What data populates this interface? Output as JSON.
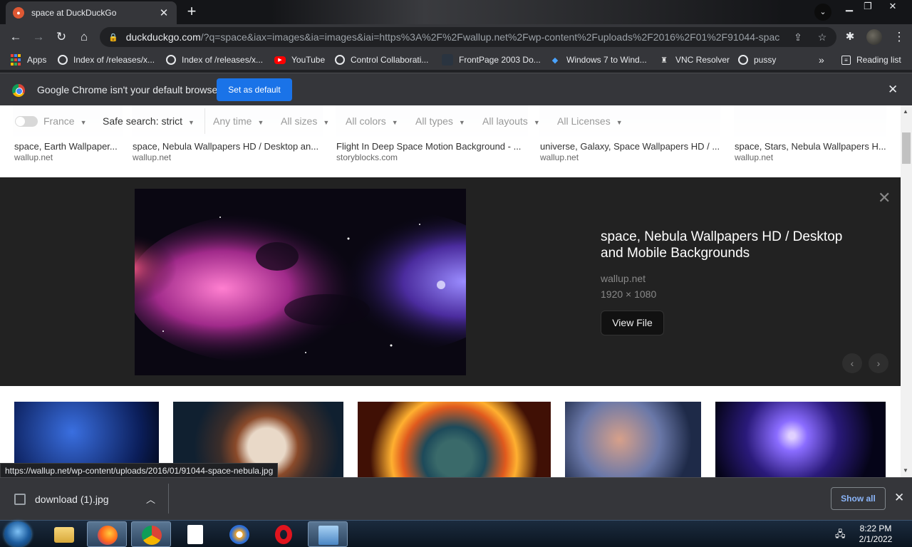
{
  "browser": {
    "tab_title": "space at DuckDuckGo",
    "url_host": "duckduckgo.com",
    "url_path": "/?q=space&iax=images&ia=images&iai=https%3A%2F%2Fwallup.net%2Fwp-content%2Fuploads%2F2016%2F01%2F91044-space-..."
  },
  "bookmarks": [
    {
      "label": "Apps",
      "icon": "apps-grid-icon"
    },
    {
      "label": "Index of /releases/x...",
      "icon": "globe-icon"
    },
    {
      "label": "Index of /releases/x...",
      "icon": "globe-icon"
    },
    {
      "label": "YouTube",
      "icon": "youtube-icon"
    },
    {
      "label": "Control Collaborati...",
      "icon": "globe-icon"
    },
    {
      "label": "FrontPage 2003 Do...",
      "icon": "page-icon"
    },
    {
      "label": "Windows 7 to Wind...",
      "icon": "windows-icon"
    },
    {
      "label": "VNC Resolver",
      "icon": "vnc-icon"
    },
    {
      "label": "pussy",
      "icon": "globe-icon"
    }
  ],
  "bookmarks_more": "»",
  "reading_list": "Reading list",
  "infobar": {
    "message": "Google Chrome isn't your default browser",
    "button": "Set as default"
  },
  "filters": {
    "region": "France",
    "safe_search": "Safe search: strict",
    "time": "Any time",
    "sizes": "All sizes",
    "colors": "All colors",
    "types": "All types",
    "layouts": "All layouts",
    "licenses": "All Licenses"
  },
  "top_results": [
    {
      "caption": "space, Earth Wallpaper...",
      "source": "wallup.net"
    },
    {
      "caption": "space, Nebula Wallpapers HD / Desktop an...",
      "source": "wallup.net"
    },
    {
      "caption": "Flight In Deep Space Motion Background - ...",
      "source": "storyblocks.com"
    },
    {
      "caption": "universe, Galaxy, Space Wallpapers HD / ...",
      "source": "wallup.net"
    },
    {
      "caption": "space, Stars, Nebula Wallpapers H...",
      "source": "wallup.net"
    }
  ],
  "detail": {
    "title": "space, Nebula Wallpapers HD / Desktop and Mobile Backgrounds",
    "source": "wallup.net",
    "dimensions": "1920 × 1080",
    "view_button": "View File"
  },
  "status_url": "https://wallup.net/wp-content/uploads/2016/01/91044-space-nebula.jpg",
  "download": {
    "filename": "download (1).jpg",
    "show_all": "Show all"
  },
  "clock": {
    "time": "8:22 PM",
    "date": "2/1/2022"
  },
  "colors": {
    "accent_blue": "#1a73e8",
    "chrome_dark": "#35363a",
    "detail_bg": "#222222"
  }
}
